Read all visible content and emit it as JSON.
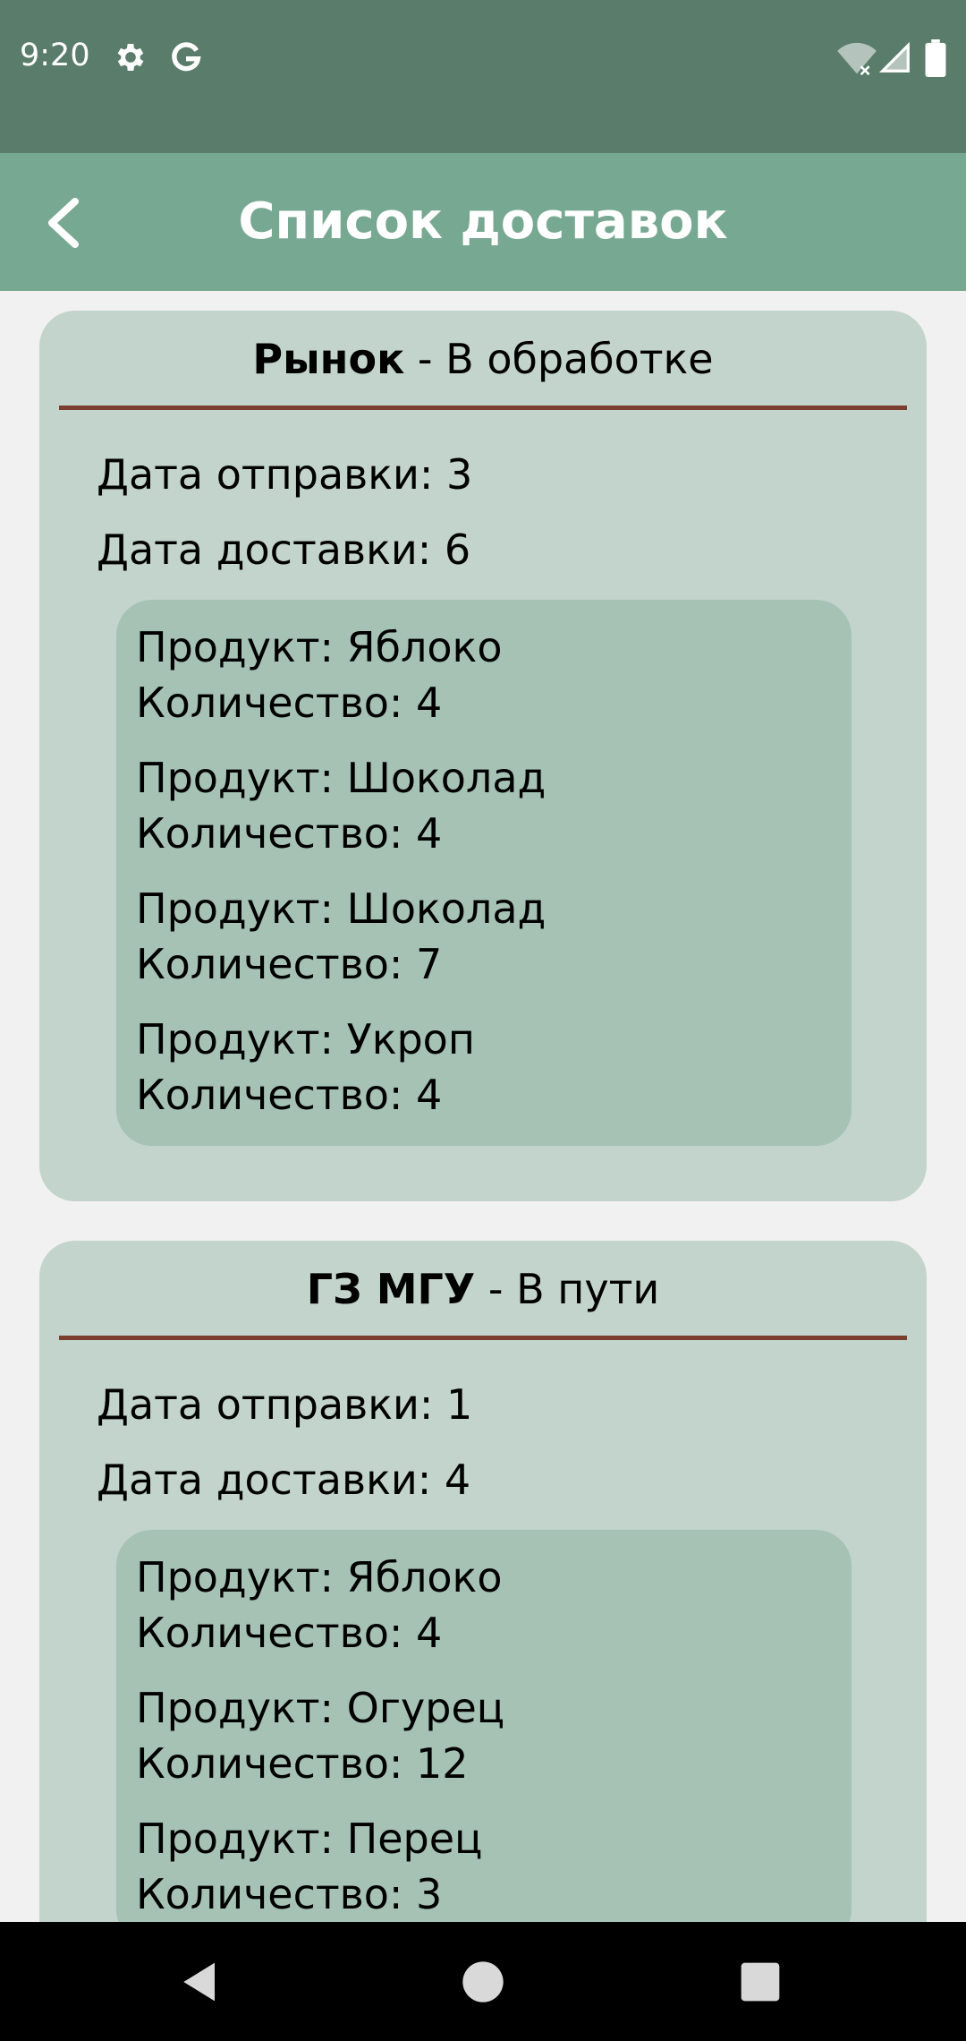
{
  "status_bar": {
    "time": "9:20",
    "icons": [
      "gear-icon",
      "google-icon",
      "wifi-icon",
      "signal-icon",
      "battery-icon"
    ]
  },
  "app_bar": {
    "title": "Список доставок",
    "back_icon": "chevron-left-icon"
  },
  "deliveries": [
    {
      "place": "Рынок",
      "status": " - В обработке",
      "send_date": "Дата отправки: 3",
      "delivery_date": "Дата доставки: 6",
      "products": [
        {
          "product": "Продукт: Яблоко",
          "quantity": "Количество: 4"
        },
        {
          "product": "Продукт: Шоколад",
          "quantity": "Количество: 4"
        },
        {
          "product": "Продукт: Шоколад",
          "quantity": "Количество: 7"
        },
        {
          "product": "Продукт: Укроп",
          "quantity": "Количество: 4"
        }
      ]
    },
    {
      "place": "ГЗ МГУ",
      "status": " - В пути",
      "send_date": "Дата отправки: 1",
      "delivery_date": "Дата доставки: 4",
      "products": [
        {
          "product": "Продукт: Яблоко",
          "quantity": "Количество: 4"
        },
        {
          "product": "Продукт: Огурец",
          "quantity": "Количество: 12"
        },
        {
          "product": "Продукт: Перец",
          "quantity": "Количество: 3"
        }
      ]
    }
  ],
  "nav_bar": {
    "icons": [
      "back-triangle-icon",
      "home-circle-icon",
      "recents-square-icon"
    ]
  },
  "colors": {
    "status_bar": "#5a7d6b",
    "app_bar": "#77a891",
    "card": "#c2d4cb",
    "products_box": "#a5c2b4",
    "divider": "#7b3e2e",
    "background": "#f1f1f1"
  }
}
